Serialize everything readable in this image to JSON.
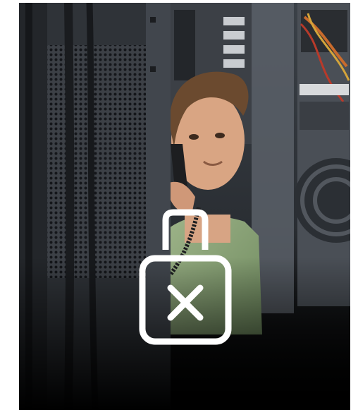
{
  "image": {
    "description_icon": "locked-lock-with-x-icon",
    "overlay_color": "#ffffff",
    "bottom_fade_color": "#000000"
  },
  "accessibility": {
    "caption": ""
  }
}
